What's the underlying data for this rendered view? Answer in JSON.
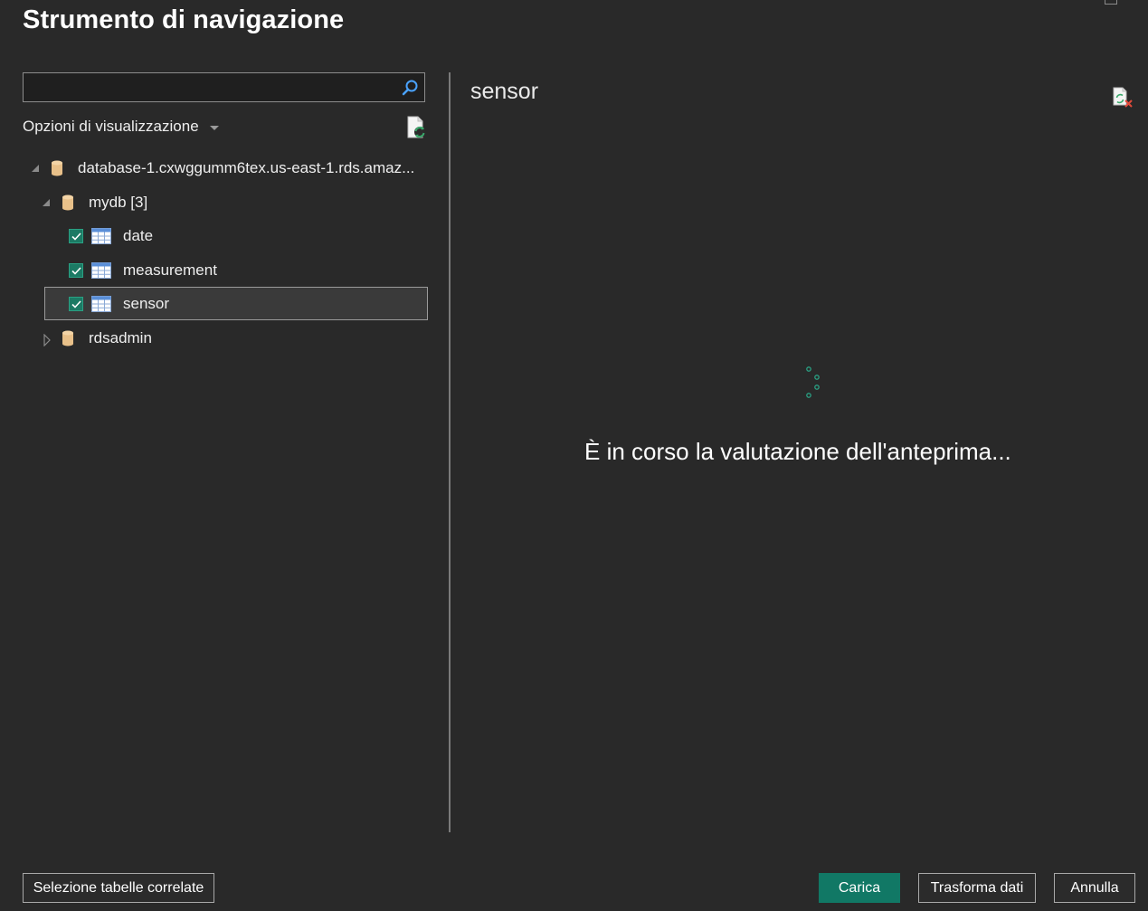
{
  "window": {
    "title": "Strumento di navigazione"
  },
  "search": {
    "value": "",
    "placeholder": ""
  },
  "view_options": {
    "label": "Opzioni di visualizzazione"
  },
  "tree": {
    "server": {
      "label": "database-1.cxwggumm6tex.us-east-1.rds.amaz...",
      "expanded": true
    },
    "databases": [
      {
        "label": "mydb [3]",
        "expanded": true,
        "tables": [
          {
            "label": "date",
            "checked": true,
            "selected": false
          },
          {
            "label": "measurement",
            "checked": true,
            "selected": false
          },
          {
            "label": "sensor",
            "checked": true,
            "selected": true
          }
        ]
      },
      {
        "label": "rdsadmin",
        "expanded": false
      }
    ]
  },
  "preview": {
    "title": "sensor",
    "loading_message": "È in corso la valutazione dell'anteprima..."
  },
  "buttons": {
    "related_tables": "Selezione tabelle correlate",
    "load": "Carica",
    "transform": "Trasforma dati",
    "cancel": "Annulla"
  },
  "colors": {
    "background": "#292929",
    "accent": "#117865",
    "checkbox": "#1c7a64",
    "db_icon": "#e8c089",
    "table_icon_header": "#5a8fd8"
  }
}
